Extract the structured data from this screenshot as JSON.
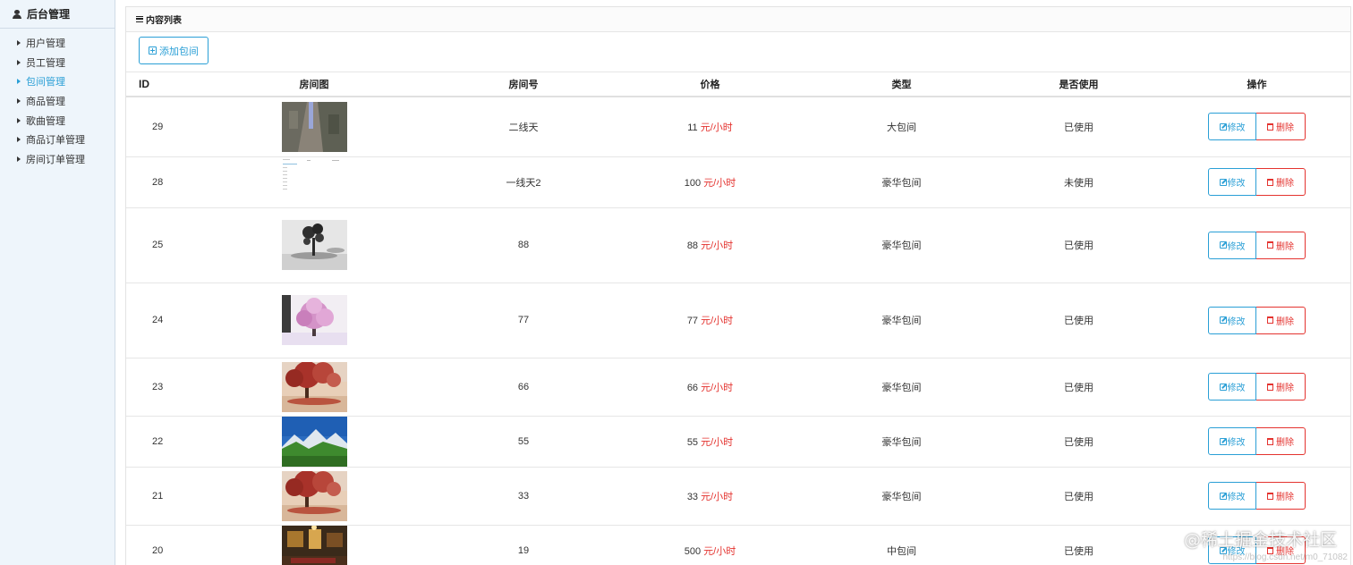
{
  "sidebar": {
    "title": "后台管理",
    "items": [
      {
        "label": "用户管理",
        "active": false
      },
      {
        "label": "员工管理",
        "active": false
      },
      {
        "label": "包间管理",
        "active": true
      },
      {
        "label": "商品管理",
        "active": false
      },
      {
        "label": "歌曲管理",
        "active": false
      },
      {
        "label": "商品订单管理",
        "active": false
      },
      {
        "label": "房间订单管理",
        "active": false
      }
    ]
  },
  "panel": {
    "title": "内容列表",
    "add_button": "添加包间"
  },
  "table": {
    "headers": [
      "ID",
      "房间图",
      "房间号",
      "价格",
      "类型",
      "是否使用",
      "操作"
    ],
    "price_unit": "元/小时",
    "edit_label": "修改",
    "delete_label": "删除",
    "rows": [
      {
        "id": "29",
        "image": "stone-path-cliff",
        "room": "二线天",
        "price": "11",
        "type": "大包间",
        "status": "已使用"
      },
      {
        "id": "28",
        "image": "screenshot-thumbnail",
        "room": "一线天2",
        "price": "100",
        "type": "豪华包间",
        "status": "未使用"
      },
      {
        "id": "25",
        "image": "ink-tree",
        "room": "88",
        "price": "88",
        "type": "豪华包间",
        "status": "已使用"
      },
      {
        "id": "24",
        "image": "pink-blossom-tree",
        "room": "77",
        "price": "77",
        "type": "豪华包间",
        "status": "已使用"
      },
      {
        "id": "23",
        "image": "red-autumn-tree",
        "room": "66",
        "price": "66",
        "type": "豪华包间",
        "status": "已使用"
      },
      {
        "id": "22",
        "image": "mountain-landscape",
        "room": "55",
        "price": "55",
        "type": "豪华包间",
        "status": "已使用"
      },
      {
        "id": "21",
        "image": "red-autumn-tree",
        "room": "33",
        "price": "33",
        "type": "豪华包间",
        "status": "已使用"
      },
      {
        "id": "20",
        "image": "karaoke-room-interior",
        "room": "19",
        "price": "500",
        "type": "中包间",
        "status": "已使用"
      }
    ]
  },
  "watermark": {
    "text": "@稀土掘金技术社区",
    "url": "https://blog.csdn.net/m0_71082"
  },
  "colors": {
    "accent": "#2a9fd6",
    "danger": "#e4332f",
    "sidebar_bg": "#eef5fb"
  }
}
